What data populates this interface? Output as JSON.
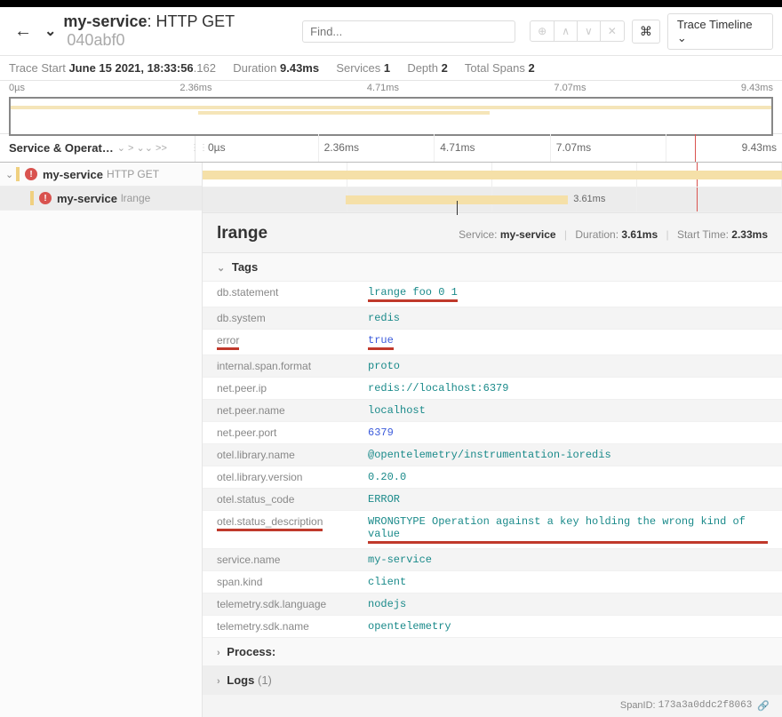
{
  "header": {
    "service": "my-service",
    "operation": "HTTP GET",
    "trace_id": "040abf0",
    "find_placeholder": "Find...",
    "trace_timeline_label": "Trace Timeline"
  },
  "stats": {
    "trace_start_label": "Trace Start",
    "trace_start": "June 15 2021, 18:33:56",
    "trace_start_ms": ".162",
    "duration_label": "Duration",
    "duration": "9.43ms",
    "services_label": "Services",
    "services": "1",
    "depth_label": "Depth",
    "depth": "2",
    "total_spans_label": "Total Spans",
    "total_spans": "2"
  },
  "ticks": [
    "0µs",
    "2.36ms",
    "4.71ms",
    "7.07ms",
    "9.43ms"
  ],
  "left_header": "Service & Operat…",
  "tree": [
    {
      "service": "my-service",
      "op": "HTTP GET"
    },
    {
      "service": "my-service",
      "op": "lrange"
    }
  ],
  "span2_duration": "3.61ms",
  "detail": {
    "title": "lrange",
    "service_label": "Service:",
    "service": "my-service",
    "duration_label": "Duration:",
    "duration": "3.61ms",
    "start_label": "Start Time:",
    "start": "2.33ms",
    "tags_label": "Tags",
    "process_label": "Process:",
    "logs_label": "Logs",
    "logs_count": "(1)",
    "spanid_label": "SpanID:",
    "spanid": "173a3a0ddc2f8063"
  },
  "tags": [
    {
      "key": "db.statement",
      "val": "lrange foo 0 1",
      "cls": "",
      "ul": true
    },
    {
      "key": "db.system",
      "val": "redis",
      "cls": ""
    },
    {
      "key": "error",
      "val": "true",
      "cls": "blue",
      "ul": true,
      "keyul": true
    },
    {
      "key": "internal.span.format",
      "val": "proto",
      "cls": ""
    },
    {
      "key": "net.peer.ip",
      "val": "redis://localhost:6379",
      "cls": ""
    },
    {
      "key": "net.peer.name",
      "val": "localhost",
      "cls": ""
    },
    {
      "key": "net.peer.port",
      "val": "6379",
      "cls": "blue"
    },
    {
      "key": "otel.library.name",
      "val": "@opentelemetry/instrumentation-ioredis",
      "cls": ""
    },
    {
      "key": "otel.library.version",
      "val": "0.20.0",
      "cls": ""
    },
    {
      "key": "otel.status_code",
      "val": "ERROR",
      "cls": ""
    },
    {
      "key": "otel.status_description",
      "val": "WRONGTYPE Operation against a key holding the wrong kind of value",
      "cls": "",
      "ul": true,
      "keyul": true
    },
    {
      "key": "service.name",
      "val": "my-service",
      "cls": ""
    },
    {
      "key": "span.kind",
      "val": "client",
      "cls": ""
    },
    {
      "key": "telemetry.sdk.language",
      "val": "nodejs",
      "cls": ""
    },
    {
      "key": "telemetry.sdk.name",
      "val": "opentelemetry",
      "cls": ""
    }
  ]
}
